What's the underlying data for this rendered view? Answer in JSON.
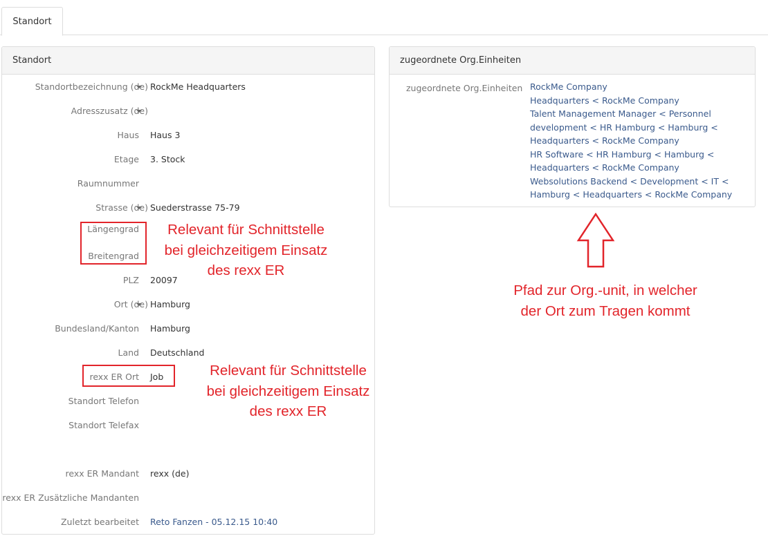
{
  "tabs": [
    {
      "label": "Standort"
    }
  ],
  "standort_panel": {
    "title": "Standort",
    "fields": [
      {
        "label": "Standortbezeichnung (de)",
        "value": "RockMe Headquarters",
        "dropdown": true
      },
      {
        "label": "Adresszusatz (de)",
        "value": "",
        "dropdown": true
      },
      {
        "label": "Haus",
        "value": "Haus 3",
        "dropdown": false
      },
      {
        "label": "Etage",
        "value": "3. Stock",
        "dropdown": false
      },
      {
        "label": "Raumnummer",
        "value": "",
        "dropdown": false
      },
      {
        "label": "Strasse (de)",
        "value": "Suederstrasse 75-79",
        "dropdown": true
      },
      {
        "label": "Längengrad",
        "value": "",
        "dropdown": false
      },
      {
        "label": "Breitengrad",
        "value": "",
        "dropdown": false
      },
      {
        "label": "PLZ",
        "value": "20097",
        "dropdown": false
      },
      {
        "label": "Ort (de)",
        "value": "Hamburg",
        "dropdown": true
      },
      {
        "label": "Bundesland/Kanton",
        "value": "Hamburg",
        "dropdown": false
      },
      {
        "label": "Land",
        "value": "Deutschland",
        "dropdown": false
      },
      {
        "label": "rexx ER Ort",
        "value": "Job",
        "dropdown": false
      },
      {
        "label": "Standort Telefon",
        "value": "",
        "dropdown": false
      },
      {
        "label": "Standort Telefax",
        "value": "",
        "dropdown": false
      },
      {
        "label": "rexx ER Mandant",
        "value": "rexx (de)",
        "dropdown": false
      },
      {
        "label": "rexx ER Zusätzliche Mandanten",
        "value": "",
        "dropdown": false
      },
      {
        "label": "Zuletzt bearbeitet",
        "value": "Reto Fanzen - 05.12.15 10:40",
        "dropdown": false,
        "link": true
      }
    ]
  },
  "org_panel": {
    "title": "zugeordnete Org.Einheiten",
    "label": "zugeordnete Org.Einheiten",
    "units": [
      "RockMe Company",
      "Headquarters < RockMe Company",
      "Talent Management Manager < Personnel development < HR Hamburg < Hamburg < Headquarters < RockMe Company",
      "HR Software < HR Hamburg < Hamburg < Headquarters < RockMe Company",
      "Websolutions Backend < Development < IT < Hamburg < Headquarters < RockMe Company"
    ]
  },
  "annotations": {
    "coords_note": [
      "Relevant für Schnittstelle",
      "bei gleichzeitigem Einsatz",
      "des rexx ER"
    ],
    "er_ort_note": [
      "Relevant für Schnittstelle",
      "bei gleichzeitigem Einsatz",
      "des rexx ER"
    ],
    "org_path_note": [
      "Pfad zur Org.-unit, in welcher",
      "der Ort zum Tragen kommt"
    ]
  },
  "colors": {
    "accent_red": "#e2242a",
    "link_blue": "#3a5a8c"
  }
}
